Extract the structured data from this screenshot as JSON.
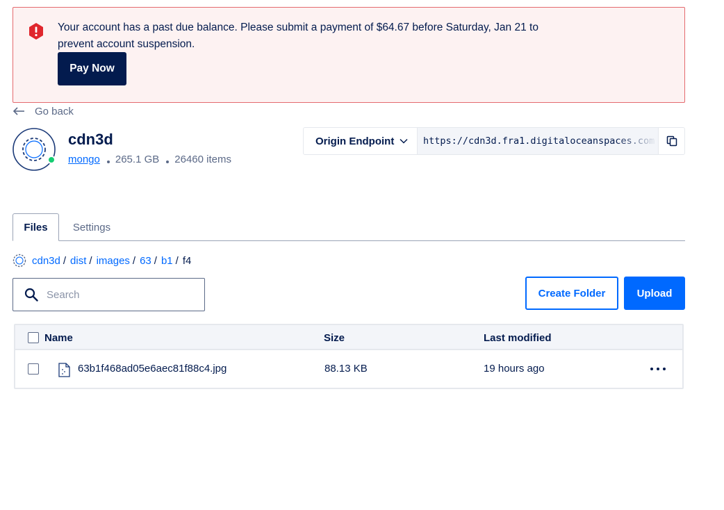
{
  "alert": {
    "message": "Your account has a past due balance. Please submit a payment of $64.67 before Saturday, Jan 21 to prevent account suspension.",
    "pay_label": "Pay Now"
  },
  "nav": {
    "go_back_label": "Go back"
  },
  "space": {
    "name": "cdn3d",
    "project": "mongo",
    "size": "265.1 GB",
    "items": "26460 items"
  },
  "endpoint": {
    "selector_label": "Origin Endpoint",
    "url": "https://cdn3d.fra1.digitaloceanspaces.com"
  },
  "tabs": [
    {
      "label": "Files"
    },
    {
      "label": "Settings"
    }
  ],
  "breadcrumb": [
    {
      "label": "cdn3d"
    },
    {
      "label": "dist"
    },
    {
      "label": "images"
    },
    {
      "label": "63"
    },
    {
      "label": "b1"
    },
    {
      "label": "f4"
    }
  ],
  "search": {
    "placeholder": "Search"
  },
  "actions": {
    "create_folder_label": "Create Folder",
    "upload_label": "Upload"
  },
  "table": {
    "columns": [
      "Name",
      "Size",
      "Last modified"
    ],
    "rows": [
      {
        "name": "63b1f468ad05e6aec81f88c4.jpg",
        "size": "88.13 KB",
        "modified": "19 hours ago"
      }
    ]
  },
  "colors": {
    "primary": "#0069ff",
    "navy": "#031b4e",
    "alert_bg": "#fdf2f2",
    "alert_border": "#e46a6e",
    "danger": "#e0262d",
    "online": "#15cd72"
  }
}
